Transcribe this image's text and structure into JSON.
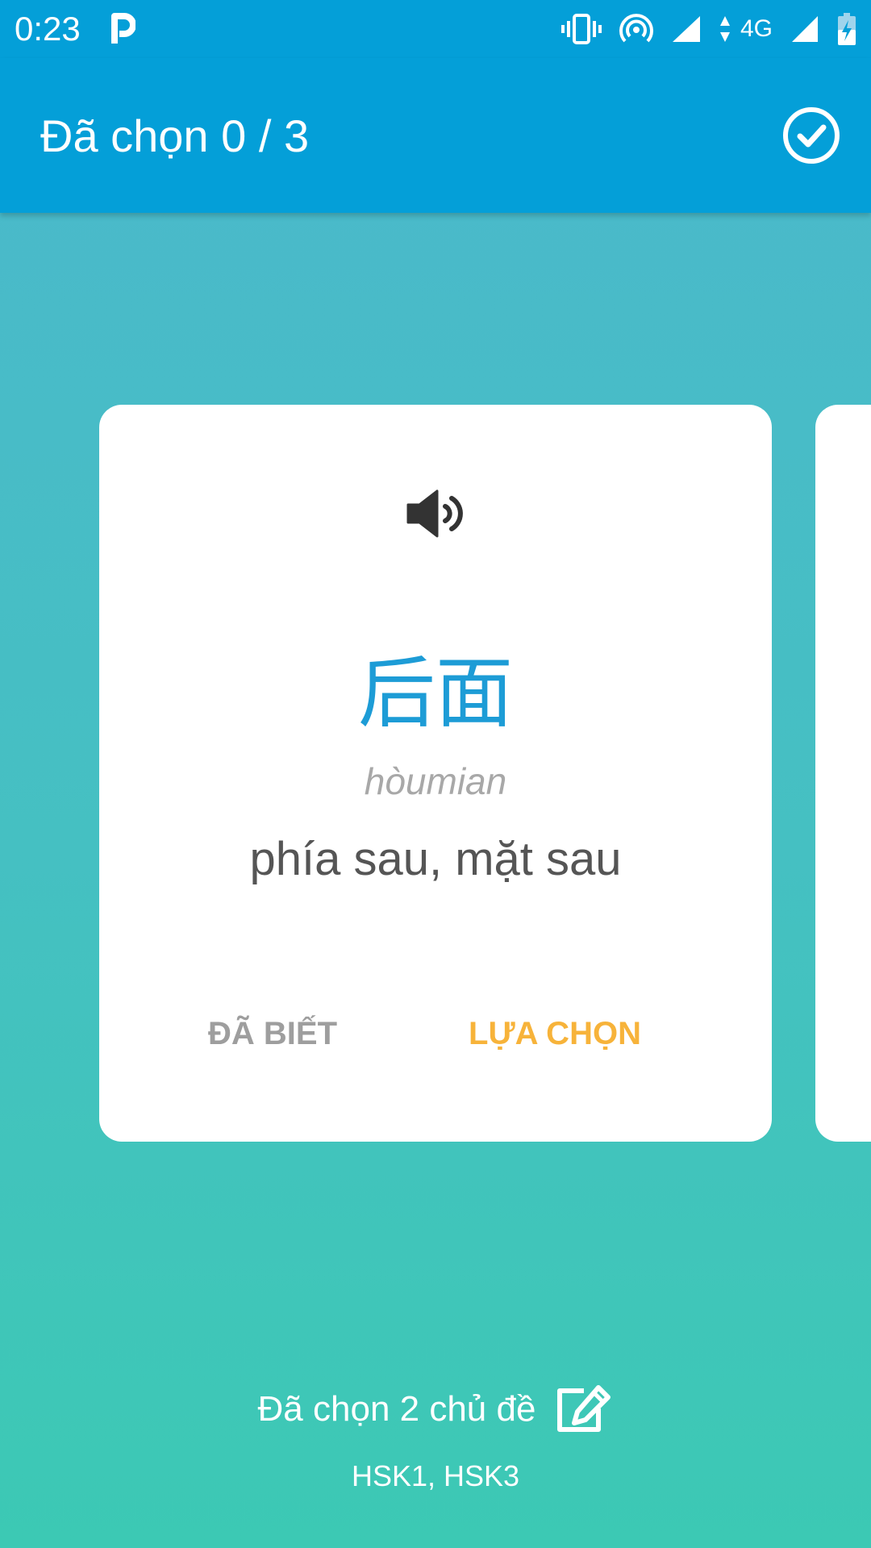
{
  "status_bar": {
    "time": "0:23",
    "notification_icon": "parking-p-icon",
    "network_label": "4G",
    "icons": [
      "vibrate-icon",
      "hotspot-icon",
      "signal-icon",
      "signal-icon",
      "battery-charging-icon"
    ]
  },
  "app_bar": {
    "title": "Đã chọn 0 / 3",
    "confirm_icon": "check-circle-icon"
  },
  "card": {
    "speaker_icon": "speaker-icon",
    "hanzi": "后面",
    "pinyin": "hòumian",
    "meaning": "phía sau, mặt sau",
    "known_button": "ĐÃ BIẾT",
    "select_button": "LỰA CHỌN"
  },
  "footer": {
    "topics_label": "Đã chọn 2 chủ đề",
    "edit_icon": "edit-icon",
    "topics_list": "HSK1, HSK3"
  },
  "colors": {
    "primary": "#049fd8",
    "hanzi": "#1d9cd6",
    "select_accent": "#f7b33a",
    "known_text": "#9e9e9e",
    "background_top": "#4bb8cc",
    "background_bottom": "#3cc9b4"
  }
}
